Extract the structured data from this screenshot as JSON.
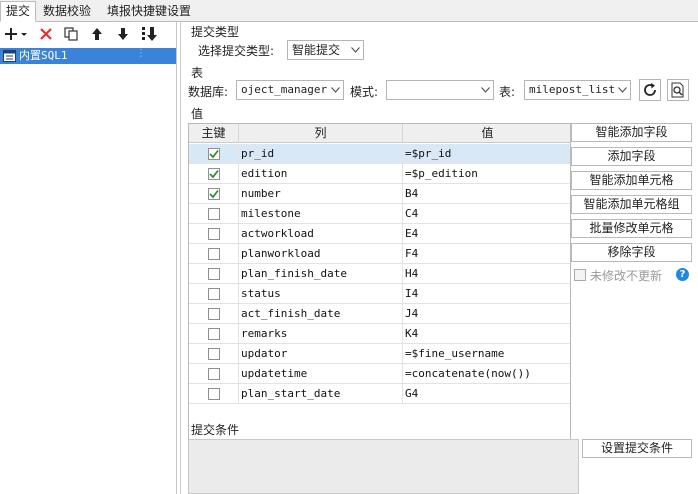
{
  "tabs": [
    {
      "label": "提交"
    },
    {
      "label": "数据校验"
    },
    {
      "label": "填报快捷键设置"
    }
  ],
  "tree": {
    "item_label": "内置SQL1"
  },
  "submit_type": {
    "section_label": "提交类型",
    "field_label": "选择提交类型:",
    "value": "智能提交"
  },
  "table_section": {
    "section_label": "表",
    "db_label": "数据库:",
    "db_value": "oject_manager",
    "mode_label": "模式:",
    "mode_value": "",
    "table_label": "表:",
    "table_value": "milepost_list"
  },
  "values_section": {
    "section_label": "值",
    "columns": [
      "主键",
      "列",
      "值"
    ],
    "rows": [
      {
        "key": true,
        "column": "pr_id",
        "value": "=$pr_id"
      },
      {
        "key": true,
        "column": "edition",
        "value": "=$p_edition"
      },
      {
        "key": true,
        "column": "number",
        "value": "B4"
      },
      {
        "key": false,
        "column": "milestone",
        "value": "C4"
      },
      {
        "key": false,
        "column": "actworkload",
        "value": "E4"
      },
      {
        "key": false,
        "column": "planworkload",
        "value": "F4"
      },
      {
        "key": false,
        "column": "plan_finish_date",
        "value": "H4"
      },
      {
        "key": false,
        "column": "status",
        "value": "I4"
      },
      {
        "key": false,
        "column": "act_finish_date",
        "value": "J4"
      },
      {
        "key": false,
        "column": "remarks",
        "value": "K4"
      },
      {
        "key": false,
        "column": "updator",
        "value": "=$fine_username"
      },
      {
        "key": false,
        "column": "updatetime",
        "value": "=concatenate(now())"
      },
      {
        "key": false,
        "column": "plan_start_date",
        "value": "G4"
      }
    ]
  },
  "actions": {
    "smart_add_field": "智能添加字段",
    "add_field": "添加字段",
    "smart_add_cell": "智能添加单元格",
    "smart_add_cell_group": "智能添加单元格组",
    "batch_edit_cell": "批量修改单元格",
    "remove_field": "移除字段",
    "no_update_unchanged": "未修改不更新"
  },
  "conditions": {
    "section_label": "提交条件",
    "set_button": "设置提交条件"
  },
  "colors": {
    "accent": "#3b83d9",
    "selected_row": "#d9e8f6",
    "check": "#2f8f2f",
    "delete": "#e03030"
  }
}
